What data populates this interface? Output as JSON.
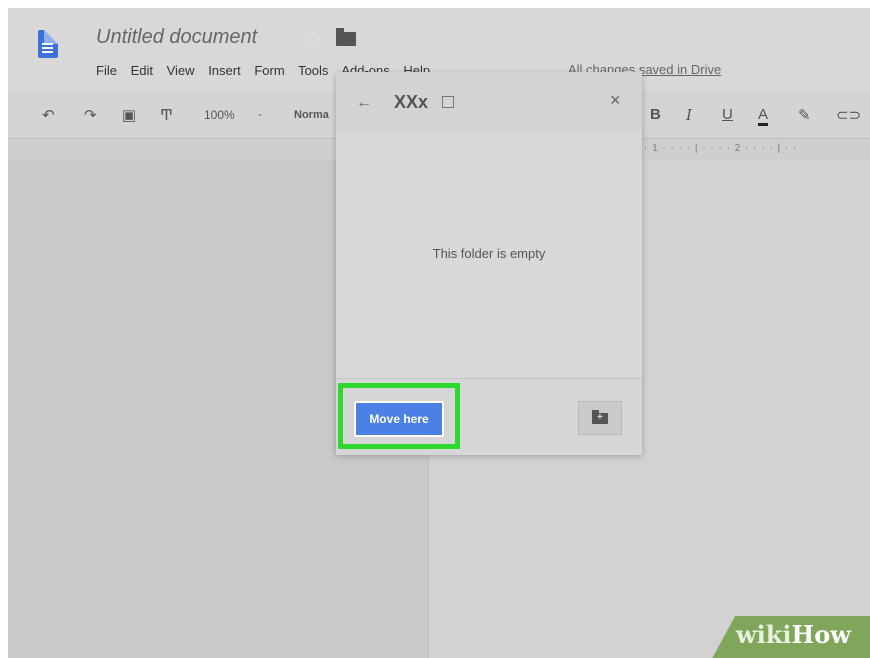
{
  "document": {
    "title": "Untitled document",
    "saved_status": "All changes saved in Drive"
  },
  "menu": {
    "items": [
      "File",
      "Edit",
      "View",
      "Insert",
      "Form",
      "Tools",
      "Add-ons",
      "Help"
    ]
  },
  "toolbar": {
    "zoom": "100%",
    "style": "Norma",
    "bold": "B",
    "italic": "I",
    "underline": "U",
    "text_color": "A"
  },
  "ruler": {
    "ticks": "· 1 · · · · | · · · · 2 · · · · | · ·"
  },
  "dialog": {
    "folder_name": "XXx",
    "empty_message": "This folder is empty",
    "move_button": "Move here"
  },
  "watermark": {
    "part1": "wiki",
    "part2": "How"
  },
  "icons": [
    "docs-icon",
    "star-icon",
    "folder-icon",
    "undo-icon",
    "redo-icon",
    "print-icon",
    "paint-format-icon",
    "back-arrow-icon",
    "open-external-icon",
    "close-icon",
    "new-folder-icon",
    "highlight-icon",
    "link-icon"
  ],
  "colors": {
    "accent_blue": "#4d80e4",
    "highlight_green": "#2ed82e",
    "docs_blue": "#3f6fd8"
  }
}
